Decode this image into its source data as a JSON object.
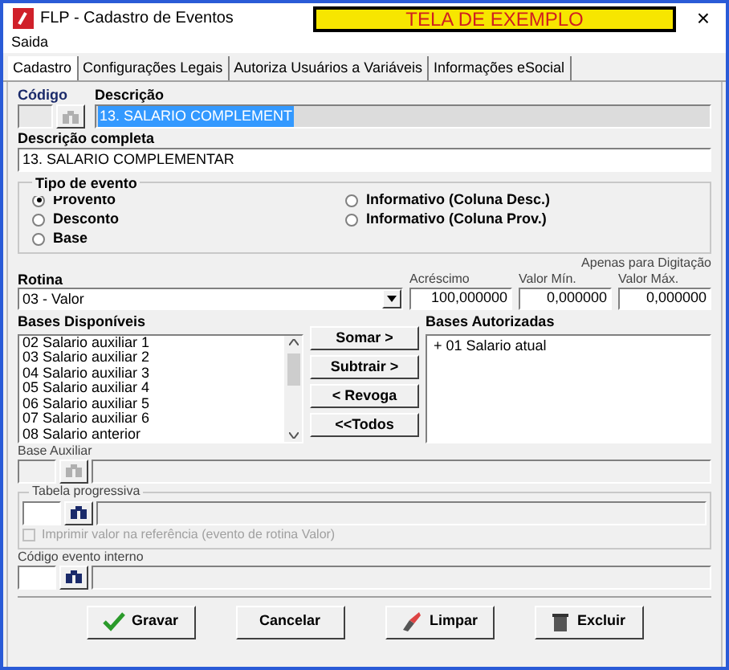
{
  "window": {
    "title": "FLP - Cadastro de Eventos",
    "banner": "TELA DE EXEMPLO",
    "close": "×"
  },
  "menu": [
    "Saida"
  ],
  "tabs": [
    {
      "label": "Cadastro",
      "selected": true
    },
    {
      "label": "Configurações Legais",
      "selected": false
    },
    {
      "label": "Autoriza Usuários a Variáveis",
      "selected": false
    },
    {
      "label": "Informações eSocial",
      "selected": false
    }
  ],
  "codigo": {
    "label": "Código"
  },
  "descricao": {
    "label": "Descrição",
    "value": "13. SALARIO COMPLEMENT"
  },
  "descricao_completa": {
    "label": "Descrição completa",
    "value": "13. SALARIO COMPLEMENTAR"
  },
  "tipo_evento": {
    "title": "Tipo de evento",
    "options": [
      {
        "label": "Provento",
        "selected": true
      },
      {
        "label": "Desconto",
        "selected": false
      },
      {
        "label": "Base",
        "selected": false
      },
      {
        "label": "Informativo (Coluna Desc.)",
        "selected": false
      },
      {
        "label": "Informativo (Coluna Prov.)",
        "selected": false
      }
    ]
  },
  "rotina": {
    "label": "Rotina",
    "value": "03 - Valor"
  },
  "digitacao_note": "Apenas para Digitação",
  "acrescimo": {
    "label": "Acréscimo",
    "value": "100,000000"
  },
  "valor_min": {
    "label": "Valor Mín.",
    "value": "0,000000"
  },
  "valor_max": {
    "label": "Valor Máx.",
    "value": "0,000000"
  },
  "bases_disponiveis": {
    "label": "Bases Disponíveis",
    "items": [
      "02 Salario auxiliar 1",
      "03 Salario auxiliar 2",
      "04 Salario auxiliar 3",
      "05 Salario auxiliar 4",
      "06 Salario auxiliar 5",
      "07 Salario auxiliar 6",
      "08 Salario anterior"
    ]
  },
  "transfer_buttons": [
    "Somar >",
    "Subtrair >",
    "< Revoga",
    "<<Todos"
  ],
  "bases_autorizadas": {
    "label": "Bases Autorizadas",
    "items": [
      "+ 01 Salario atual"
    ]
  },
  "base_auxiliar": {
    "label": "Base Auxiliar"
  },
  "tabela_progressiva": {
    "title": "Tabela progressiva",
    "checkbox": {
      "label": "Imprimir valor na referência (evento de rotina Valor)",
      "checked": false,
      "disabled": true
    }
  },
  "codigo_evento_interno": {
    "label": "Código evento interno"
  },
  "buttons": [
    {
      "label": "Gravar",
      "kind": "save"
    },
    {
      "label": "Cancelar",
      "kind": "plain"
    },
    {
      "label": "Limpar",
      "kind": "clear"
    },
    {
      "label": "Excluir",
      "kind": "delete"
    }
  ]
}
